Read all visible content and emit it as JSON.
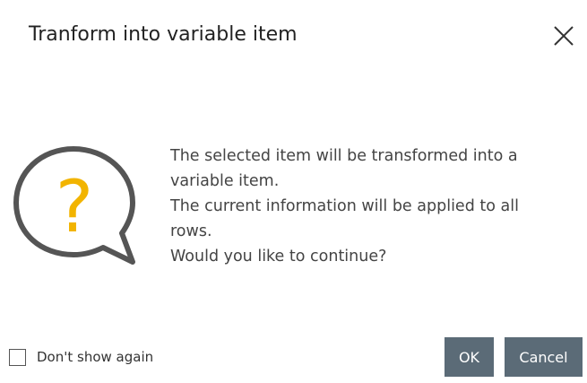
{
  "dialog": {
    "title": "Tranform into variable item",
    "close_icon": "close-icon",
    "question_icon": "question-bubble-icon",
    "message_lines": [
      "The selected item will be transformed into a",
      "variable item.",
      "The current information will be applied to all",
      "rows.",
      "Would you like to continue?"
    ],
    "question_mark": "?",
    "dont_show_again_label": "Don't show again",
    "dont_show_again_checked": false,
    "ok_label": "OK",
    "cancel_label": "Cancel"
  },
  "colors": {
    "accent_question": "#f2b400",
    "bubble_outline": "#555555",
    "button_bg": "#5b6b77",
    "button_text": "#ffffff"
  }
}
